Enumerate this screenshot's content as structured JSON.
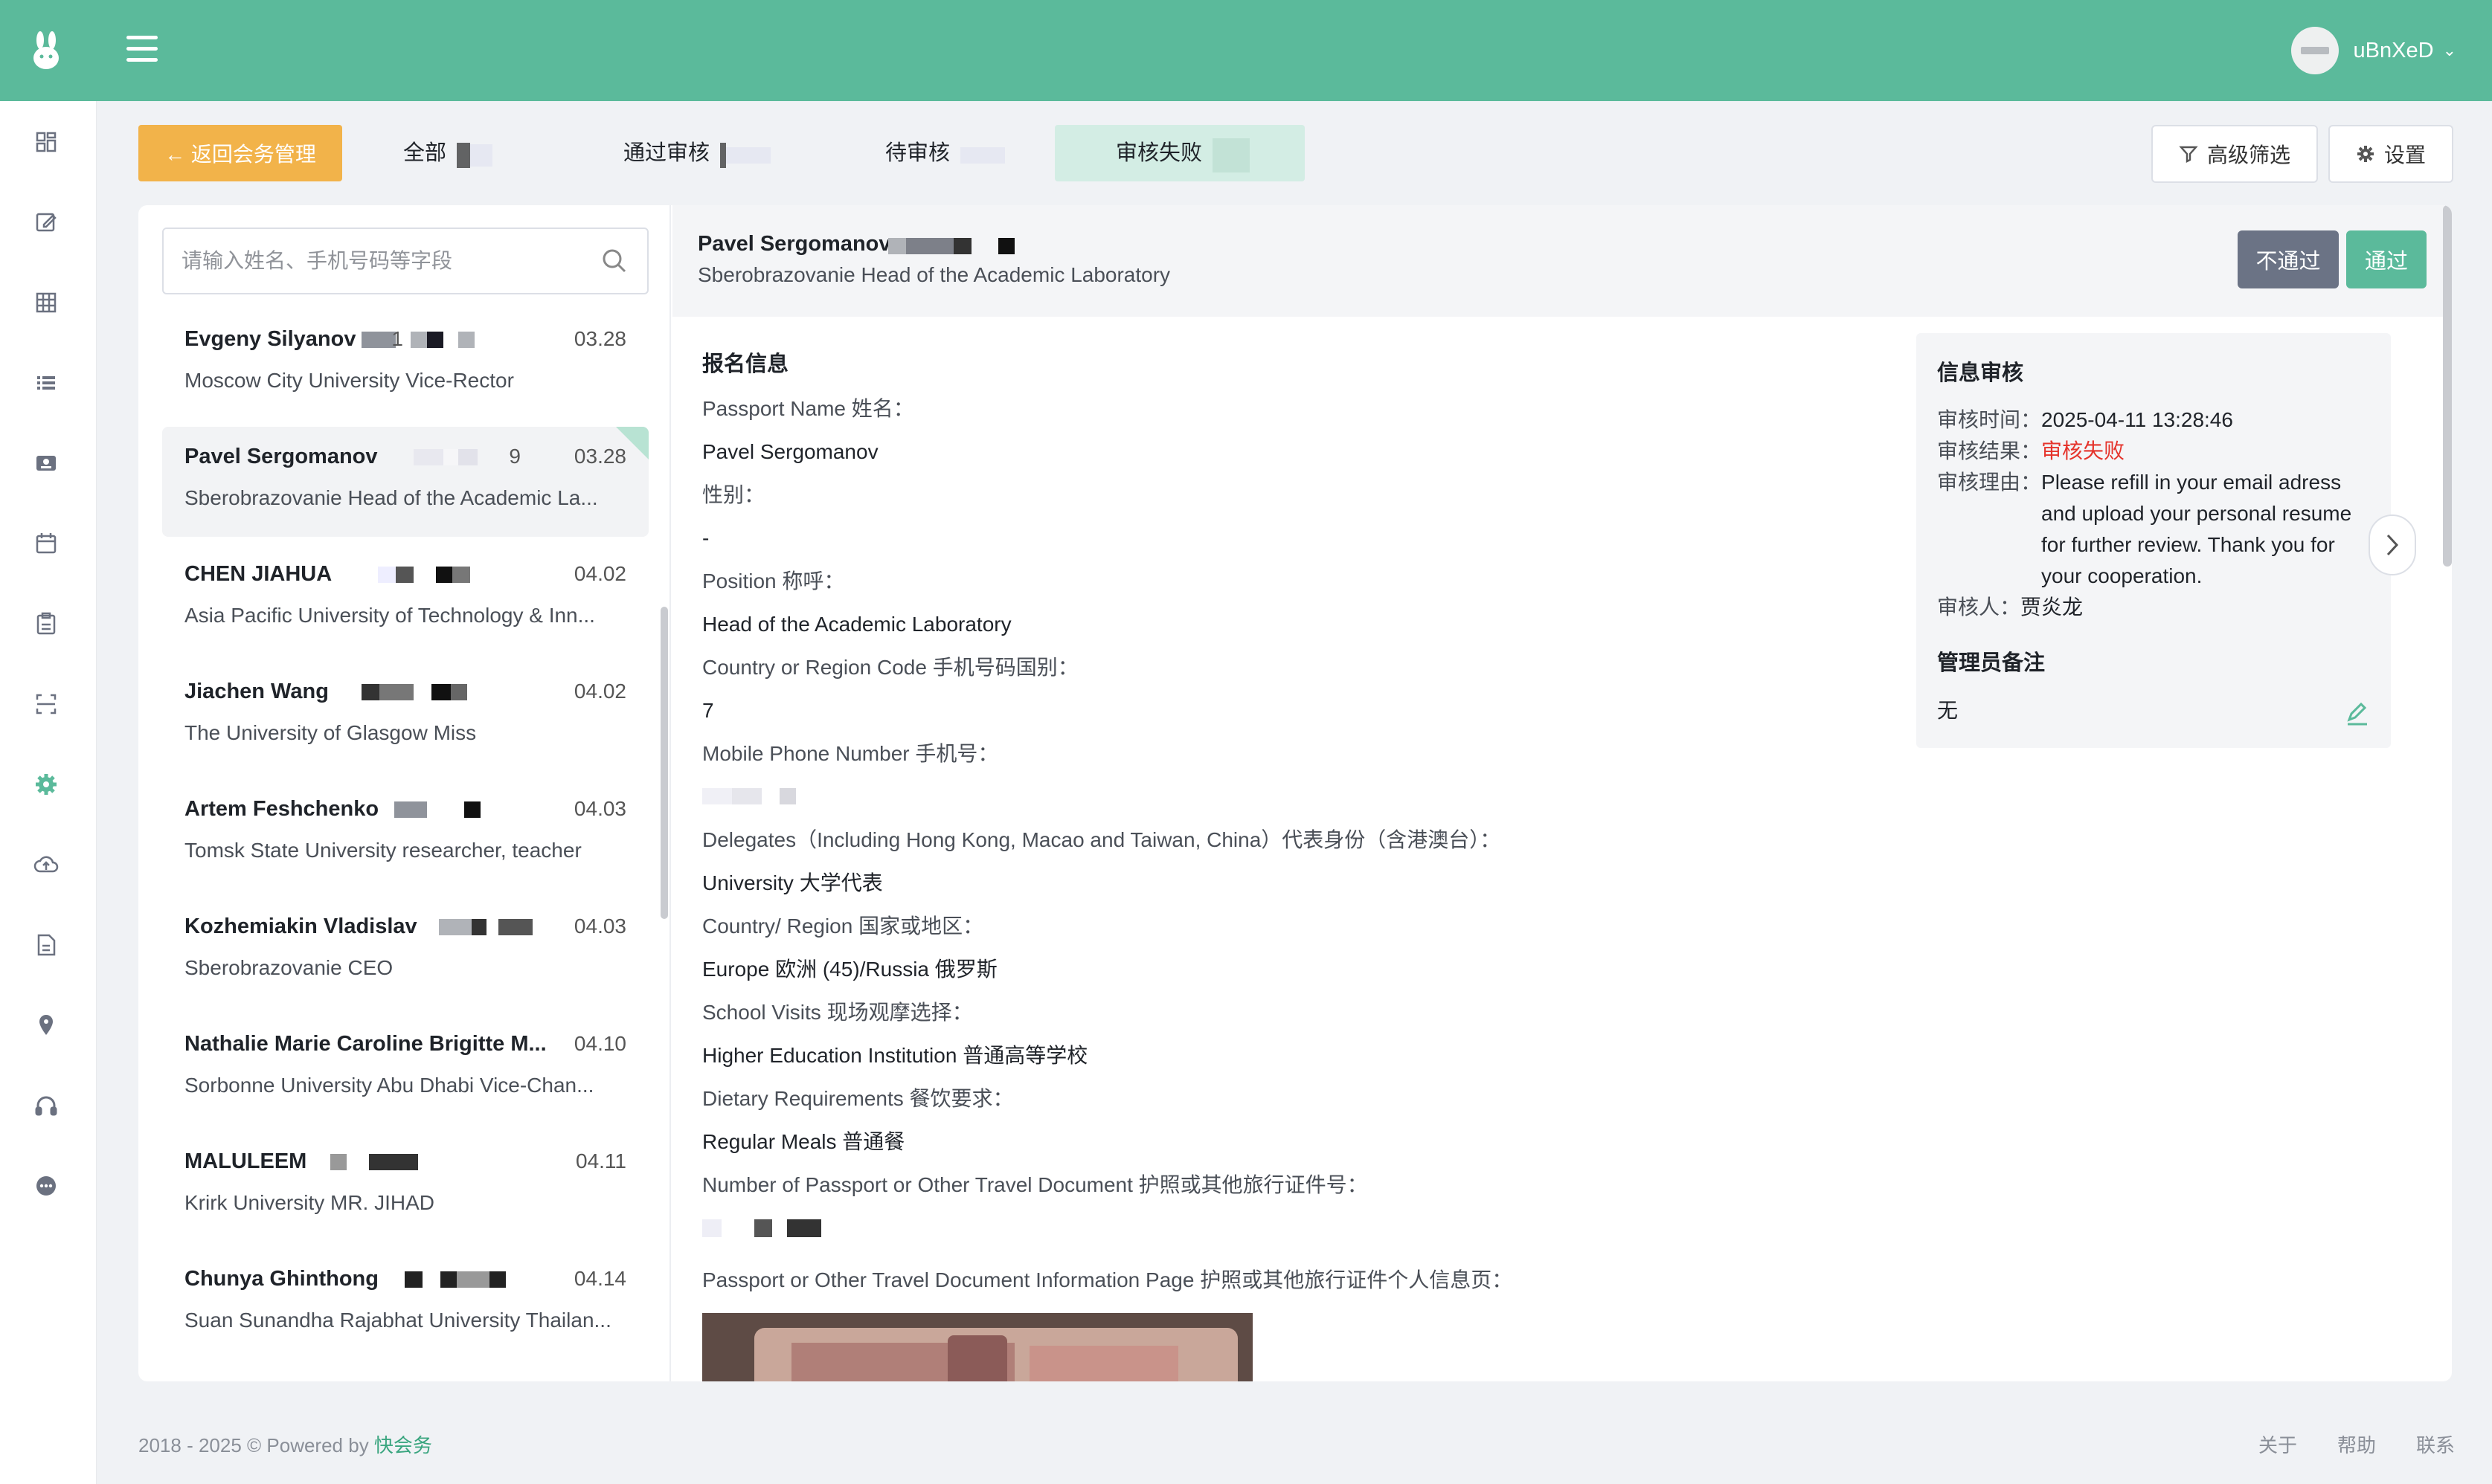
{
  "header": {
    "user_name": "uBnXeD"
  },
  "toolbar": {
    "back_label": "← 返回会务管理",
    "tabs": [
      {
        "label": "全部"
      },
      {
        "label": "通过审核"
      },
      {
        "label": "待审核"
      },
      {
        "label": "审核失败"
      }
    ],
    "filter_label": "高级筛选",
    "settings_label": "设置"
  },
  "list": {
    "search_placeholder": "请输入姓名、手机号码等字段",
    "items": [
      {
        "name": "Evgeny Silyanov",
        "suffix": "1",
        "date": "03.28",
        "sub": "Moscow City University   Vice-Rector"
      },
      {
        "name": "Pavel Sergomanov",
        "suffix": "9",
        "date": "03.28",
        "sub": "Sberobrazovanie  Head of the Academic La..."
      },
      {
        "name": "CHEN JIAHUA",
        "suffix": "",
        "date": "04.02",
        "sub": "Asia Pacific University of Technology & Inn..."
      },
      {
        "name": "Jiachen Wang",
        "suffix": "",
        "date": "04.02",
        "sub": "The University of Glasgow  Miss"
      },
      {
        "name": "Artem Feshchenko",
        "suffix": "",
        "date": "04.03",
        "sub": "Tomsk State University  researcher, teacher"
      },
      {
        "name": "Kozhemiakin Vladislav",
        "suffix": "",
        "date": "04.03",
        "sub": "Sberobrazovanie  CEO"
      },
      {
        "name": "Nathalie Marie Caroline Brigitte M...",
        "suffix": "",
        "date": "04.10",
        "sub": "Sorbonne University Abu Dhabi  Vice-Chan..."
      },
      {
        "name": "MALULEEM",
        "suffix": "",
        "date": "04.11",
        "sub": "Krirk University  MR. JIHAD"
      },
      {
        "name": "Chunya Ghinthong",
        "suffix": "",
        "date": "04.14",
        "sub": "Suan Sunandha Rajabhat University Thailan..."
      }
    ]
  },
  "detail": {
    "name": "Pavel Sergomanov",
    "subtitle": "Sberobrazovanie  Head of the Academic Laboratory",
    "reject_label": "不通过",
    "approve_label": "通过",
    "section_title": "报名信息",
    "fields": [
      {
        "label": "Passport Name 姓名：",
        "value": "Pavel Sergomanov"
      },
      {
        "label": "性别：",
        "value": "-"
      },
      {
        "label": "Position 称呼：",
        "value": "Head of the Academic Laboratory"
      },
      {
        "label": "Country or Region Code 手机号码国别：",
        "value": "7"
      },
      {
        "label": "Mobile Phone Number 手机号：",
        "value": ""
      },
      {
        "label": "Delegates（Including Hong Kong, Macao and Taiwan, China）代表身份（含港澳台）：",
        "value": "University 大学代表"
      },
      {
        "label": "Country/ Region 国家或地区：",
        "value": "Europe 欧洲 (45)/Russia 俄罗斯"
      },
      {
        "label": "School Visits 现场观摩选择：",
        "value": "Higher Education Institution 普通高等学校"
      },
      {
        "label": "Dietary Requirements 餐饮要求：",
        "value": "Regular Meals 普通餐"
      },
      {
        "label": "Number of Passport or Other Travel Document 护照或其他旅行证件号：",
        "value": ""
      }
    ],
    "passport_page_label": "Passport or Other Travel Document Information Page 护照或其他旅行证件个人信息页："
  },
  "audit": {
    "title": "信息审核",
    "time_key": "审核时间：",
    "time_val": "2025-04-11 13:28:46",
    "result_key": "审核结果：",
    "result_val": "审核失败",
    "reason_key": "审核理由：",
    "reason_val": "Please refill in your email adress and upload your personal resume for further review. Thank you for your cooperation.",
    "auditor_key": "审核人：",
    "auditor_val": "贾炎龙",
    "admin_title": "管理员备注",
    "admin_note": "无"
  },
  "footer": {
    "copyright": "2018 - 2025 © Powered by ",
    "brand": "快会务",
    "links": [
      "关于",
      "帮助",
      "联系"
    ]
  },
  "colors": {
    "brand": "#5bba9b",
    "warning": "#f2b34a",
    "danger": "#e5332b",
    "reject": "#6b7385"
  }
}
